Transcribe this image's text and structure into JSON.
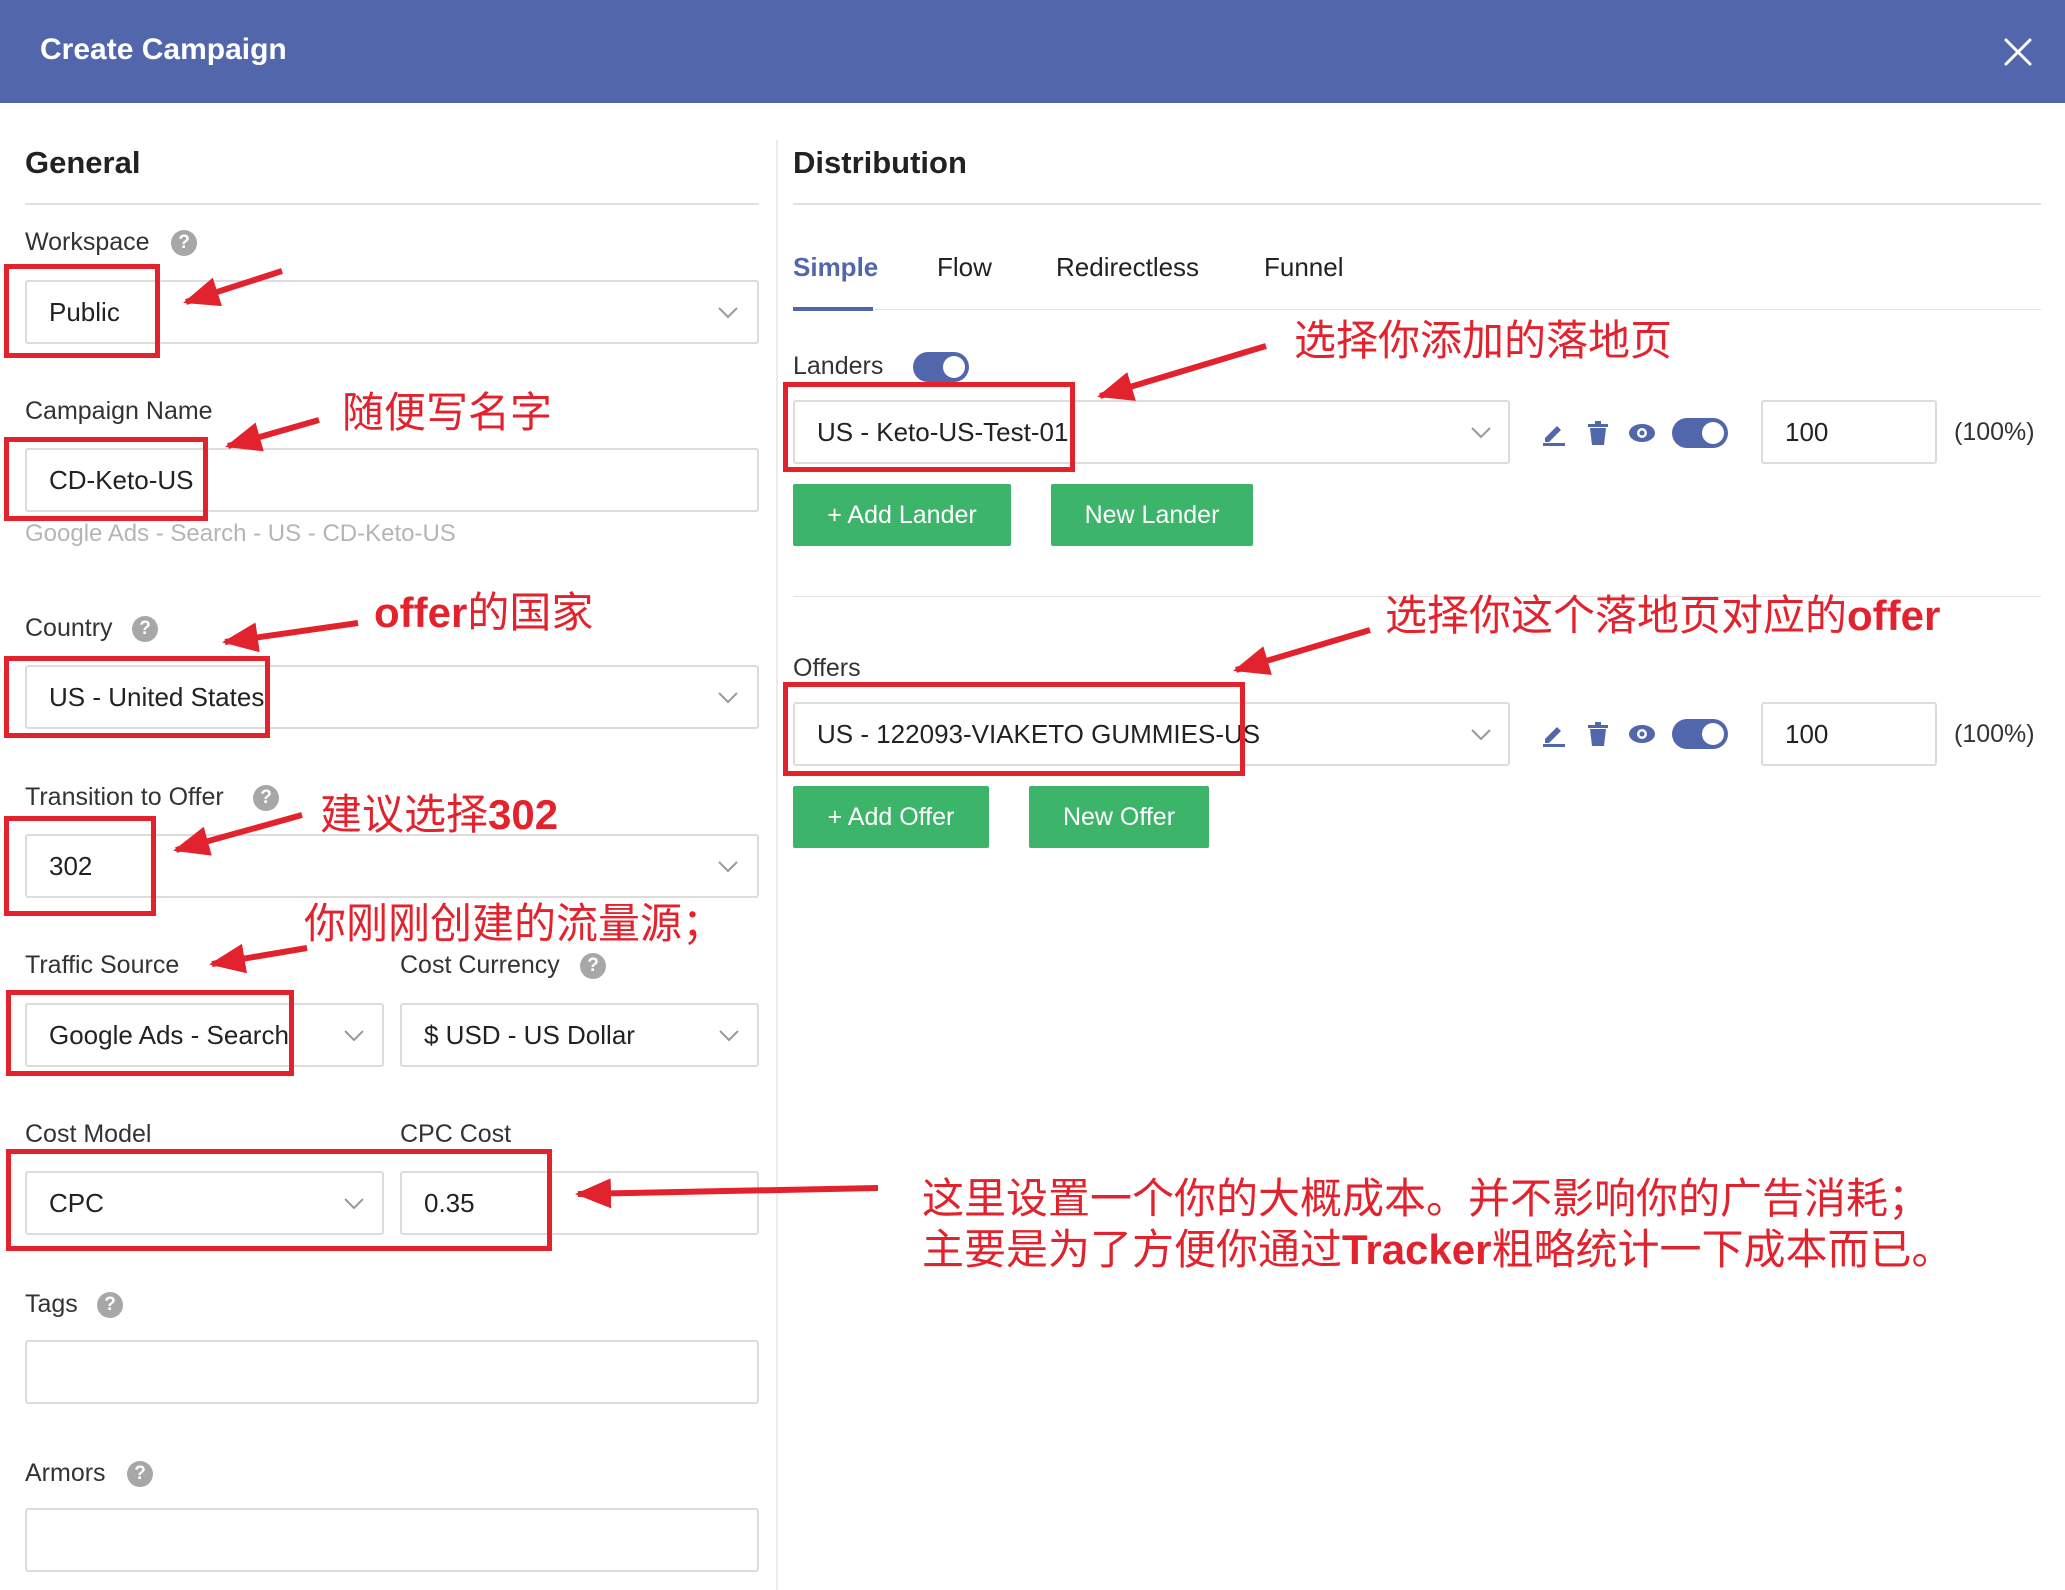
{
  "dialog": {
    "title": "Create Campaign"
  },
  "general": {
    "title": "General",
    "workspace": {
      "label": "Workspace",
      "value": "Public"
    },
    "campaign_name": {
      "label": "Campaign Name",
      "value": "CD-Keto-US",
      "hint": "Google Ads - Search - US - CD-Keto-US"
    },
    "country": {
      "label": "Country",
      "value": "US - United States"
    },
    "transition": {
      "label": "Transition to Offer",
      "value": "302"
    },
    "traffic_source": {
      "label": "Traffic Source",
      "value": "Google Ads - Search"
    },
    "cost_currency": {
      "label": "Cost Currency",
      "value": "$ USD - US Dollar"
    },
    "cost_model": {
      "label": "Cost Model",
      "value": "CPC"
    },
    "cpc_cost": {
      "label": "CPC Cost",
      "value": "0.35"
    },
    "tags": {
      "label": "Tags",
      "value": ""
    },
    "armors": {
      "label": "Armors",
      "value": ""
    }
  },
  "distribution": {
    "title": "Distribution",
    "tabs": [
      "Simple",
      "Flow",
      "Redirectless",
      "Funnel"
    ],
    "active_tab": "Simple",
    "landers": {
      "label": "Landers",
      "enabled": true,
      "item": {
        "value": "US - Keto-US-Test-01",
        "weight": "100",
        "percent": "(100%)",
        "enabled": true
      },
      "add_button": "+ Add Lander",
      "new_button": "New Lander"
    },
    "offers": {
      "label": "Offers",
      "item": {
        "value": "US - 122093-VIAKETO GUMMIES-US",
        "weight": "100",
        "percent": "(100%)",
        "enabled": true
      },
      "add_button": "+ Add Offer",
      "new_button": "New Offer"
    }
  },
  "annotations": {
    "campaign_name": "随便写名字",
    "country_pre": "offer",
    "country_post": "的国家",
    "transition_pre": "建议选择",
    "transition_bold": "302",
    "traffic_source": "你刚刚创建的流量源；",
    "landers": "选择你添加的落地页",
    "offers_pre": "选择你这个落地页对应的",
    "offers_bold": "offer",
    "cost_line1": "这里设置一个你的大概成本。并不影响你的广告消耗；",
    "cost_line2_pre": "主要是为了方便你通过",
    "cost_line2_bold": "Tracker",
    "cost_line2_post": "粗略统计一下成本而已。"
  },
  "colors": {
    "header": "#5266ac",
    "accent": "#5266ac",
    "button": "#3cb56b",
    "annotation": "#e2222c"
  },
  "icons": {
    "close": "close-icon",
    "help": "help-icon",
    "edit": "edit-icon",
    "delete": "trash-icon",
    "preview": "eye-icon",
    "dropdown": "chevron-down-icon"
  }
}
